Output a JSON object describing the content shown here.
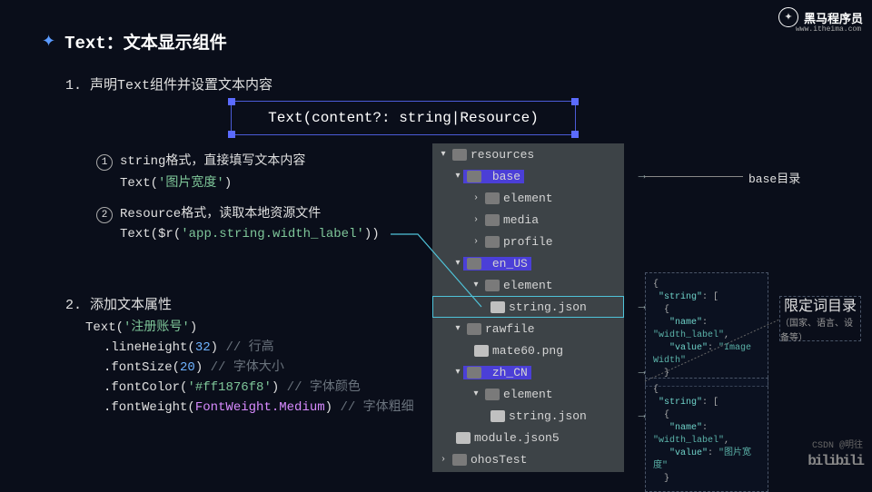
{
  "logo": {
    "brand": "黑马程序员",
    "url": "www.itheima.com",
    "icon": "✦"
  },
  "title": {
    "icon": "✦",
    "text": "Text：文本显示组件"
  },
  "section1": {
    "num": "1.",
    "text": "声明Text组件并设置文本内容"
  },
  "signature": "Text(content?: string|Resource)",
  "item1": {
    "badge": "1",
    "text": "string格式，直接填写文本内容"
  },
  "code1": {
    "fn": "Text",
    "open": "(",
    "str": "'图片宽度'",
    "close": ")"
  },
  "item2": {
    "badge": "2",
    "text": "Resource格式，读取本地资源文件"
  },
  "code2": {
    "fn": "Text",
    "open": "(",
    "dollar": "$r",
    "paren": "(",
    "str": "'app.string.width_label'",
    "close": "))"
  },
  "section2": {
    "num": "2.",
    "text": "添加文本属性"
  },
  "codeblock": {
    "l1_fn": "Text",
    "l1_open": "(",
    "l1_str": "'注册账号'",
    "l1_close": ")",
    "l2_dot": ".",
    "l2_fn": "lineHeight",
    "l2_open": "(",
    "l2_num": "32",
    "l2_close": ") ",
    "l2_comment": "// 行高",
    "l3_dot": ".",
    "l3_fn": "fontSize",
    "l3_open": "(",
    "l3_num": "20",
    "l3_close": ") ",
    "l3_comment": "// 字体大小",
    "l4_dot": ".",
    "l4_fn": "fontColor",
    "l4_open": "(",
    "l4_str": "'#ff1876f8'",
    "l4_close": ") ",
    "l4_comment": "// 字体颜色",
    "l5_dot": ".",
    "l5_fn": "fontWeight",
    "l5_open": "(",
    "l5_enum": "FontWeight.Medium",
    "l5_close": ") ",
    "l5_comment": "// 字体粗细"
  },
  "tree": {
    "resources": "resources",
    "base": "base",
    "element": "element",
    "media": "media",
    "profile": "profile",
    "en_US": "en_US",
    "string_json": "string.json",
    "rawfile": "rawfile",
    "mate60": "mate60.png",
    "zh_CN": "zh_CN",
    "module_json5": "module.json5",
    "ohosTest": "ohosTest"
  },
  "annotations": {
    "base_dir": "base目录",
    "limited_dir": "限定词目录",
    "limited_sub": "（国家、语言、设备等）"
  },
  "json_en": {
    "l1": "{",
    "l2k": "\"string\"",
    "l2c": ": [",
    "l3": "{",
    "l4k": "\"name\"",
    "l4v": "\"width_label\"",
    "l5k": "\"value\"",
    "l5v": "\"Image Width\"",
    "l6": "}",
    "l7": "]",
    "l8": "}"
  },
  "json_zh": {
    "l1": "{",
    "l2k": "\"string\"",
    "l2c": ": [",
    "l3": "{",
    "l4k": "\"name\"",
    "l4v": "\"width_label\"",
    "l5k": "\"value\"",
    "l5v": "\"图片宽度\"",
    "l6": "}",
    "l7": "]",
    "l8": "}"
  },
  "watermarks": {
    "csdn": "CSDN @明往",
    "bili": "bilibili"
  }
}
